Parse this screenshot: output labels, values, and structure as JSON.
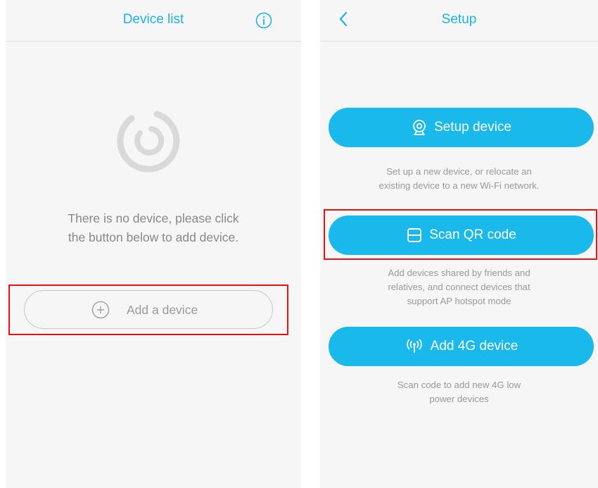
{
  "device_list": {
    "title": "Device list",
    "empty_message_line1": "There is no device, please click",
    "empty_message_line2": "the button below to add device.",
    "add_button_label": "Add a device"
  },
  "setup": {
    "title": "Setup",
    "setup_device": {
      "label": "Setup device",
      "description_line1": "Set up a new device, or relocate an",
      "description_line2": "existing device to a new Wi-Fi network."
    },
    "scan_qr": {
      "label": "Scan QR code",
      "description_line1": "Add devices shared by friends and",
      "description_line2": "relatives, and connect devices that",
      "description_line3": "support AP hotspot mode"
    },
    "add_4g": {
      "label": "Add 4G device",
      "description_line1": "Scan code to add new 4G low",
      "description_line2": "power devices"
    }
  },
  "colors": {
    "accent": "#1ab9ec",
    "title_text": "#1ab3e6",
    "highlight": "#ee1111",
    "background": "#f6f6f6"
  },
  "icons": [
    "info-icon",
    "empty-device-logo",
    "plus-circle-icon",
    "back-chevron-icon",
    "camera-icon",
    "scan-icon",
    "antenna-signal-icon"
  ]
}
